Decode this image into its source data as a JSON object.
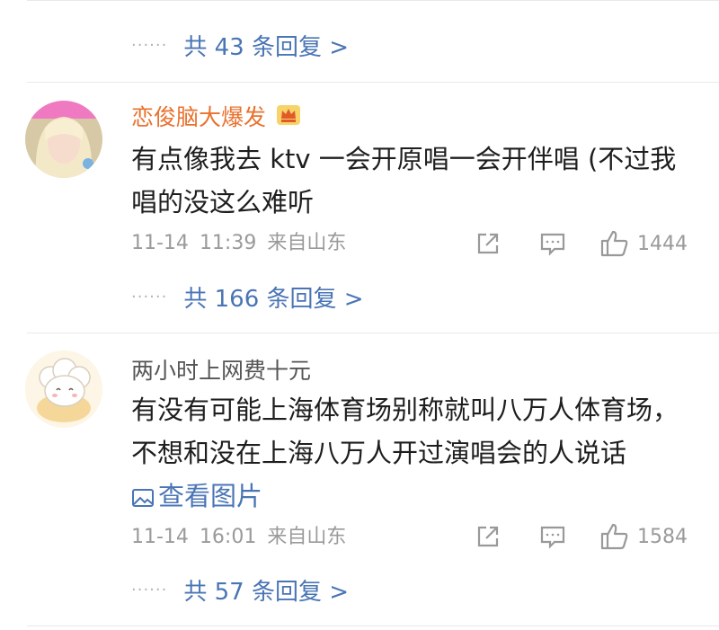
{
  "threads": [
    {
      "reply_summary": "共 43 条回复 >"
    },
    {
      "username": "恋俊脑大爆发",
      "has_crown_badge": true,
      "text": "有点像我去 ktv 一会开原唱一会开伴唱 (不过我唱的没这么难听",
      "date": "11-14",
      "time": "11:39",
      "location": "来自山东",
      "likes": "1444",
      "reply_summary": "共 166 条回复 >"
    },
    {
      "username": "两小时上网费十元",
      "text": "有没有可能上海体育场别称就叫八万人体育场，不想和没在上海八万人开过演唱会的人说话",
      "view_image": "查看图片",
      "date": "11-14",
      "time": "16:01",
      "location": "来自山东",
      "likes": "1584",
      "reply_summary": "共 57 条回复 >"
    }
  ],
  "dots": "······",
  "colors": {
    "link": "#4a75b5",
    "username_vip": "#e8722f",
    "meta": "#9a9a9a"
  }
}
